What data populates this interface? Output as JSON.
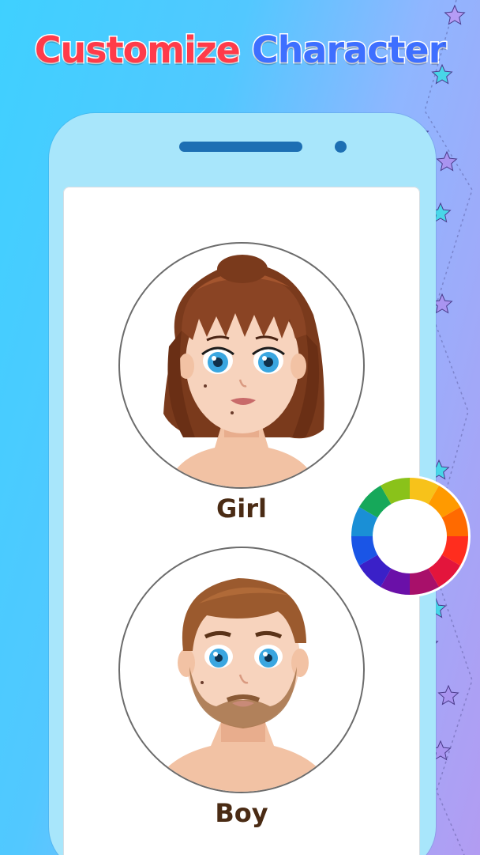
{
  "header": {
    "title_word_1": "Customize",
    "title_word_2": "Character"
  },
  "options": [
    {
      "label": "Girl",
      "icon": "girl-avatar"
    },
    {
      "label": "Boy",
      "icon": "boy-avatar"
    }
  ],
  "color_wheel": {
    "icon": "color-wheel-icon"
  },
  "colors": {
    "title_red": "#ff3b4a",
    "title_blue": "#3e6fff",
    "phone_frame": "#a8e6fb",
    "label_brown": "#4a2b14"
  }
}
